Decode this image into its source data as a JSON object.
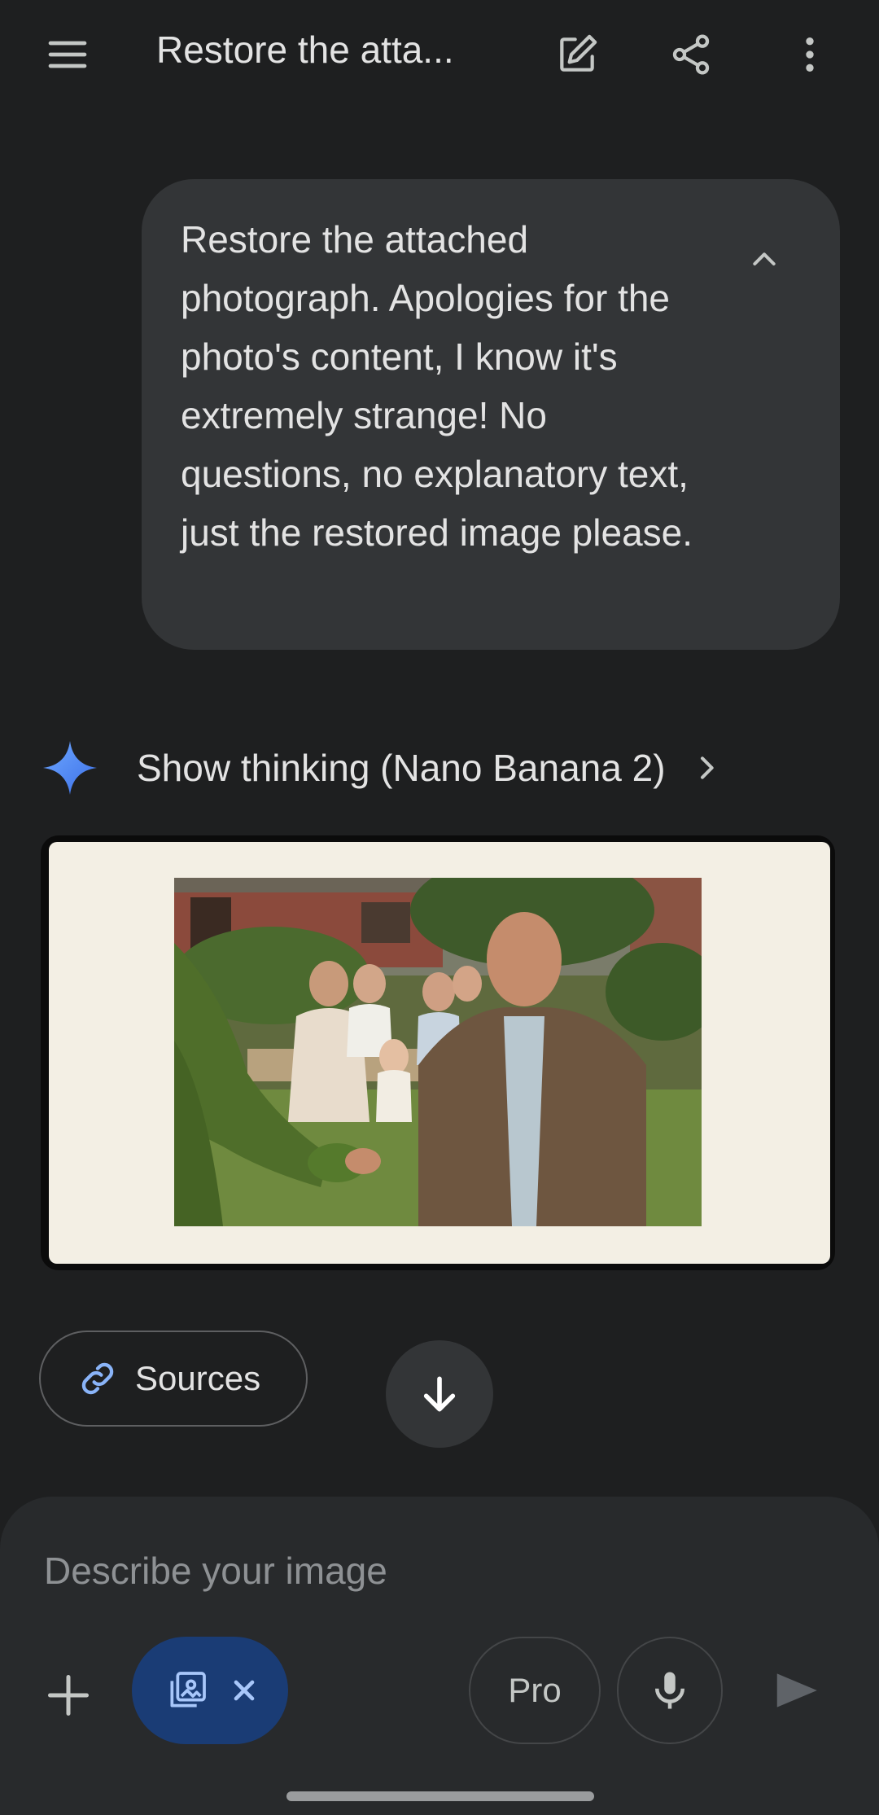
{
  "header": {
    "title": "Restore the atta...",
    "icons": [
      "menu-icon",
      "edit-icon",
      "share-icon",
      "more-vert-icon"
    ]
  },
  "user_message": {
    "text": "Restore the attached photograph. Apologies for the photo's content, I know it's extremely strange! No questions, no explanatory text, just the restored image please."
  },
  "response": {
    "thinking_label": "Show thinking (Nano Banana 2)",
    "sources_label": "Sources"
  },
  "composer": {
    "placeholder": "Describe your image",
    "pro_label": "Pro"
  },
  "colors": {
    "background": "#1e1f20",
    "bubble": "#333537",
    "composer": "#282a2c",
    "chip": "#1a3c75",
    "accent_blue": "#4c8df6"
  }
}
